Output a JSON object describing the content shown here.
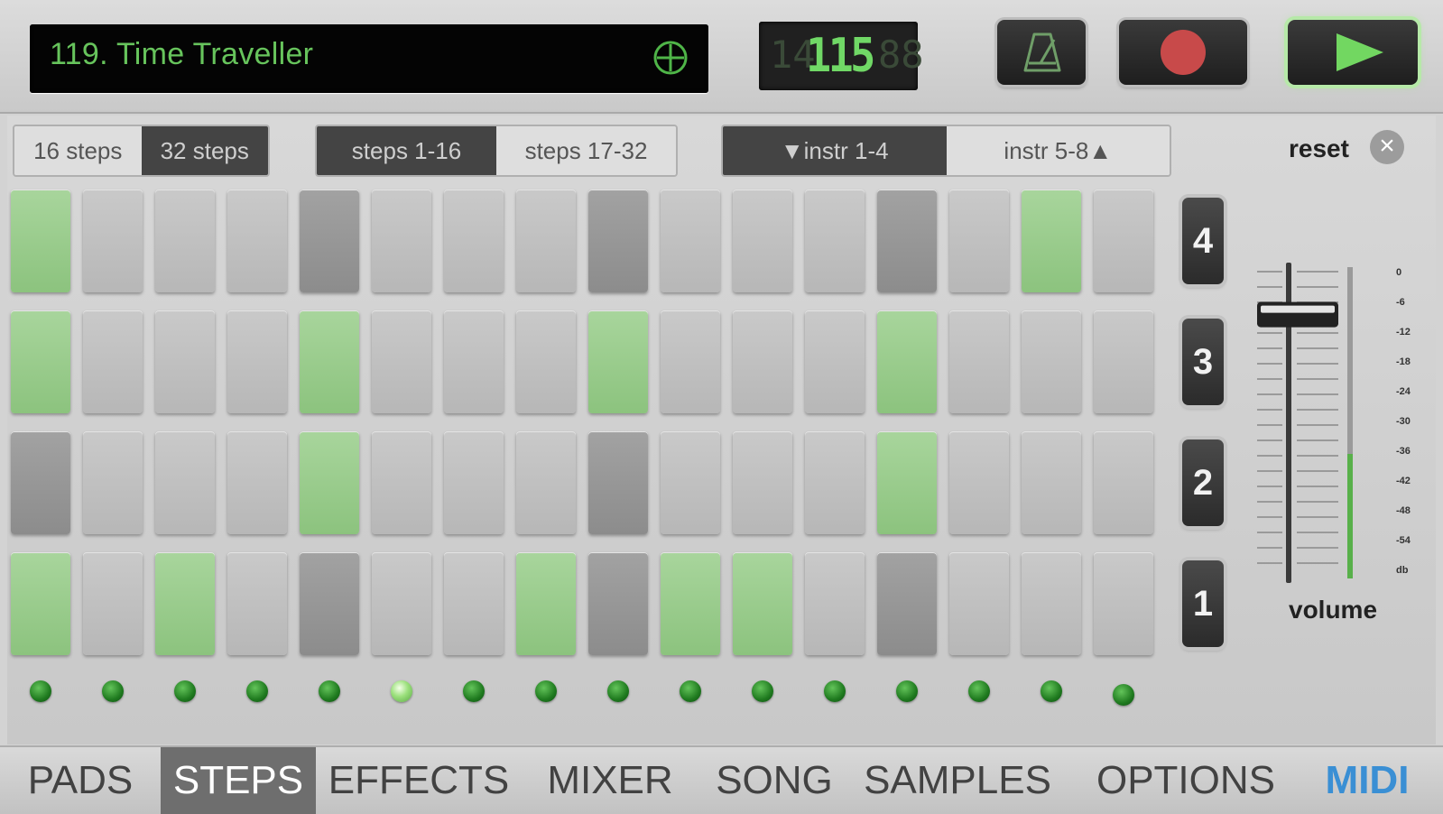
{
  "header": {
    "song_title": "119. Time Traveller",
    "tempo_ghost_left": "14",
    "tempo": "115",
    "tempo_ghost_right": "88",
    "icons": {
      "add": "plus-circle-icon",
      "metronome": "metronome-icon",
      "record": "record-icon",
      "play": "play-icon"
    }
  },
  "controls": {
    "steps_count": [
      {
        "label": "16 steps",
        "selected": false
      },
      {
        "label": "32 steps",
        "selected": true
      }
    ],
    "steps_range": [
      {
        "label": "steps 1-16",
        "selected": true
      },
      {
        "label": "steps 17-32",
        "selected": false
      }
    ],
    "instrument_range": [
      {
        "label": "▼instr 1-4",
        "selected": true
      },
      {
        "label": "instr 5-8▲",
        "selected": false
      }
    ],
    "reset_label": "reset",
    "reset_icon": "close-icon"
  },
  "grid": {
    "rows": [
      {
        "instrument": "4",
        "steps": [
          "on",
          "off",
          "off",
          "off",
          "dark",
          "off",
          "off",
          "off",
          "dark",
          "off",
          "off",
          "off",
          "dark",
          "off",
          "on",
          "off"
        ]
      },
      {
        "instrument": "3",
        "steps": [
          "on",
          "off",
          "off",
          "off",
          "on",
          "off",
          "off",
          "off",
          "on",
          "off",
          "off",
          "off",
          "on",
          "off",
          "off",
          "off"
        ]
      },
      {
        "instrument": "2",
        "steps": [
          "dark",
          "off",
          "off",
          "off",
          "on",
          "off",
          "off",
          "off",
          "dark",
          "off",
          "off",
          "off",
          "on",
          "off",
          "off",
          "off"
        ]
      },
      {
        "instrument": "1",
        "steps": [
          "on",
          "off",
          "on",
          "off",
          "dark",
          "off",
          "off",
          "on",
          "dark",
          "on",
          "on",
          "off",
          "dark",
          "off",
          "off",
          "off"
        ]
      }
    ],
    "current_step": 6
  },
  "volume": {
    "label": "volume",
    "level": 0.86,
    "meter_level": 0.4,
    "db_scale": [
      "0",
      "-6",
      "-12",
      "-18",
      "-24",
      "-30",
      "-36",
      "-42",
      "-48",
      "-54",
      "db"
    ]
  },
  "colors": {
    "pad_on": "#98cc8b",
    "display_text": "#67c45c",
    "record": "#c84a4a",
    "play": "#72d761",
    "midi_tab": "#3a8fd4"
  },
  "tabs": [
    {
      "label": "PADS",
      "active": false
    },
    {
      "label": "STEPS",
      "active": true
    },
    {
      "label": "EFFECTS",
      "active": false
    },
    {
      "label": "MIXER",
      "active": false
    },
    {
      "label": "SONG",
      "active": false
    },
    {
      "label": "SAMPLES",
      "active": false
    },
    {
      "label": "OPTIONS",
      "active": false
    },
    {
      "label": "MIDI",
      "active": false
    }
  ]
}
